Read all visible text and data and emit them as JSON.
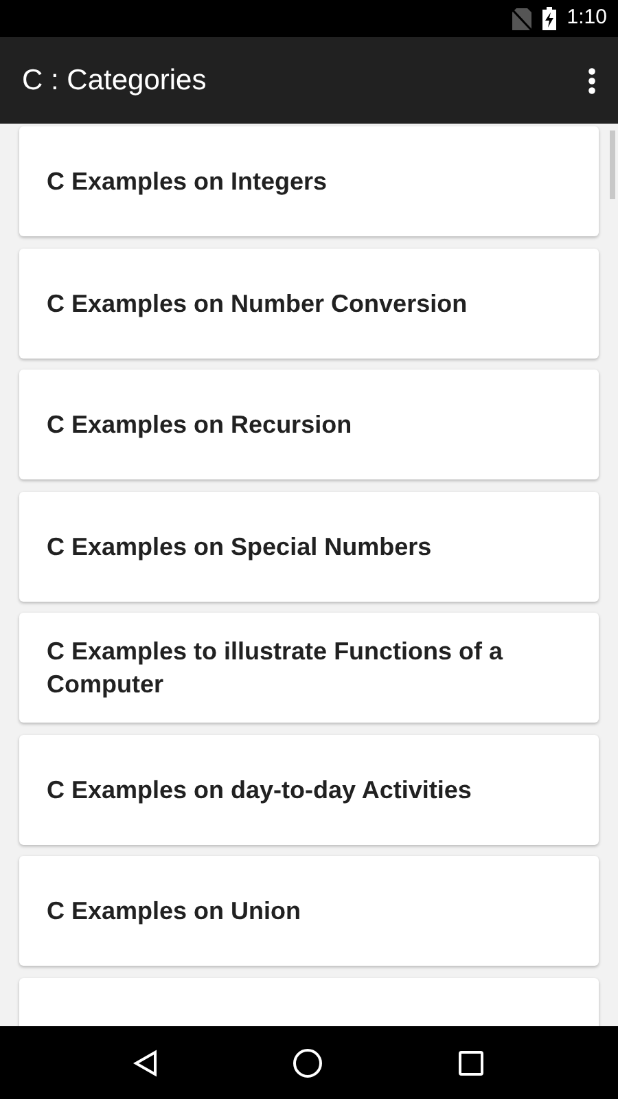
{
  "status_bar": {
    "time": "1:10"
  },
  "app_bar": {
    "title": "C : Categories"
  },
  "categories": [
    {
      "label": "C Examples on Integers"
    },
    {
      "label": "C Examples on Number Conversion"
    },
    {
      "label": "C Examples on Recursion"
    },
    {
      "label": "C Examples on Special Numbers"
    },
    {
      "label": "C Examples to illustrate Functions of a Computer"
    },
    {
      "label": "C Examples on day-to-day Activities"
    },
    {
      "label": "C Examples on Union"
    }
  ]
}
